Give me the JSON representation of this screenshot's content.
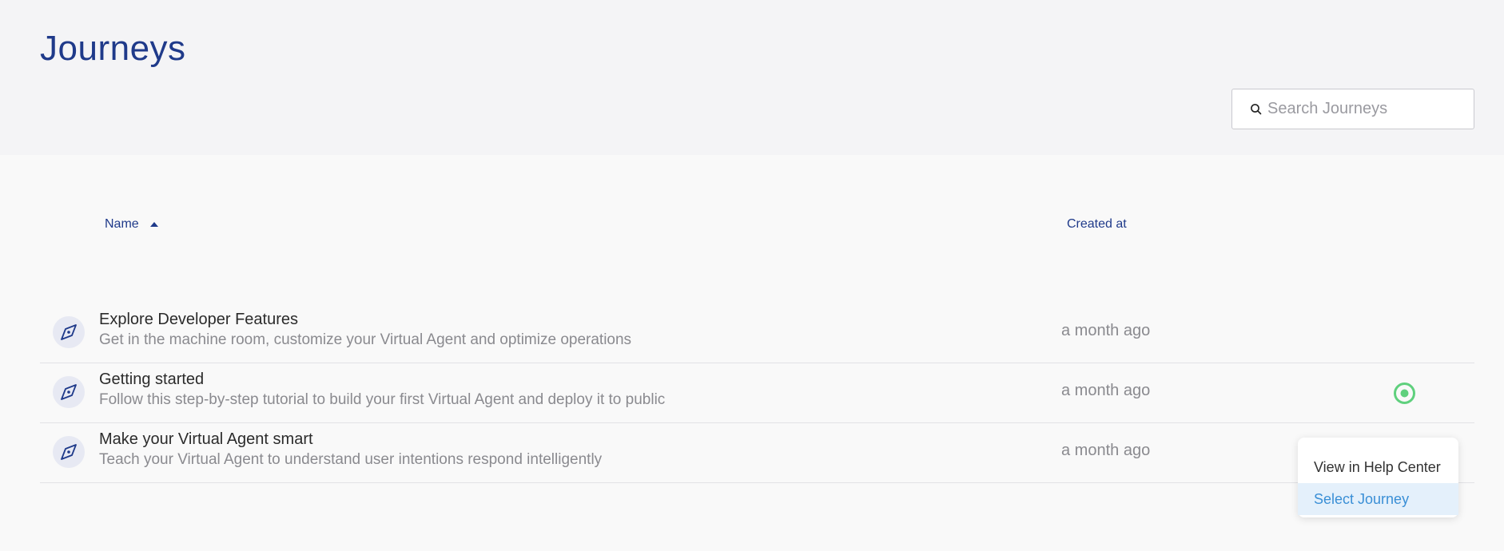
{
  "header": {
    "title": "Journeys",
    "search_placeholder": "Search Journeys"
  },
  "table": {
    "columns": {
      "name": "Name",
      "created_at": "Created at"
    },
    "sort": {
      "column": "Name",
      "direction": "ascending"
    },
    "rows": [
      {
        "title": "Explore Developer Features",
        "description": "Get in the machine room, customize your Virtual Agent and optimize operations",
        "created": "a month ago",
        "icon": "compass-icon",
        "active": false
      },
      {
        "title": "Getting started",
        "description": "Follow this step-by-step tutorial to build your first Virtual Agent and deploy it to public",
        "created": "a month ago",
        "icon": "compass-icon",
        "active": true
      },
      {
        "title": "Make your Virtual Agent smart",
        "description": "Teach your Virtual Agent to understand user intentions respond intelligently",
        "created": "a month ago",
        "icon": "compass-icon",
        "active": false
      }
    ]
  },
  "context_menu": {
    "items": [
      {
        "label": "View in Help Center",
        "highlighted": false
      },
      {
        "label": "Select Journey",
        "highlighted": true
      }
    ]
  },
  "colors": {
    "title": "#1f3a8a",
    "active_status": "#5fd07d",
    "menu_highlight_bg": "#e4f0fb",
    "menu_highlight_text": "#3a8fd6"
  }
}
